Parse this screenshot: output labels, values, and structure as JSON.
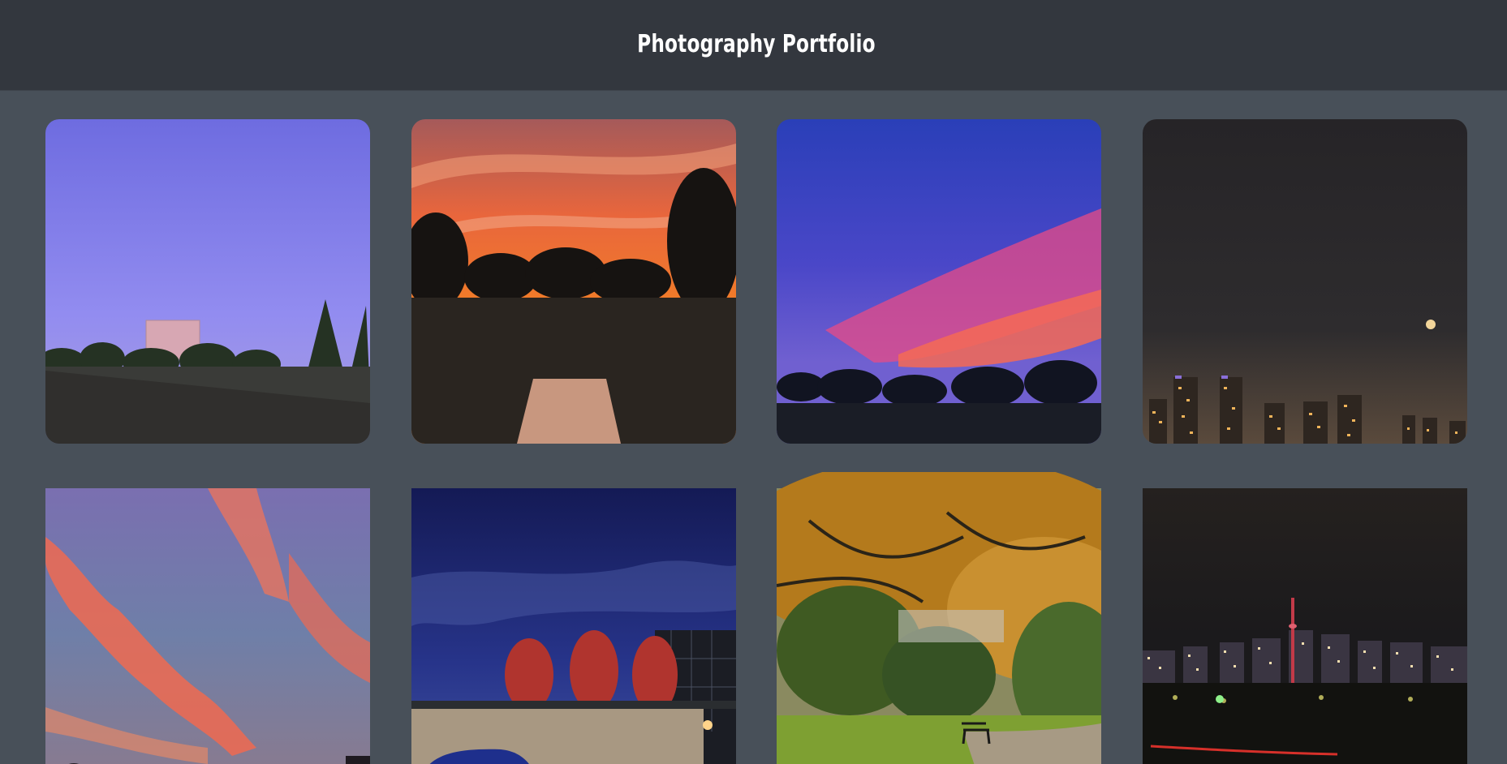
{
  "header": {
    "title": "Photography Portfolio"
  },
  "gallery": {
    "photos": [
      {
        "subject": "apartment tower at dusk under violet sky"
      },
      {
        "subject": "orange sunset over silhouetted trees and bench"
      },
      {
        "subject": "blue and pink sunset sky over treeline"
      },
      {
        "subject": "city skyline at night with moon"
      },
      {
        "subject": "pink clouds in sunset sky"
      },
      {
        "subject": "blue night sky over red trees and parked car"
      },
      {
        "subject": "autumn park with bench and path"
      },
      {
        "subject": "city skyline at night with red-lit tower"
      }
    ]
  }
}
